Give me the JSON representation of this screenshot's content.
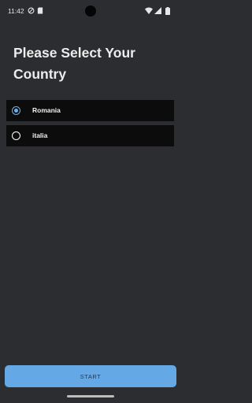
{
  "status_bar": {
    "time": "11:42",
    "left_icons": [
      "do-not-disturb-icon",
      "sd-card-icon"
    ],
    "right_icons": [
      "wifi-icon",
      "signal-icon",
      "battery-icon"
    ]
  },
  "page": {
    "title": "Please Select Your Country"
  },
  "countries": [
    {
      "label": "Romania",
      "selected": true
    },
    {
      "label": "italia",
      "selected": false
    }
  ],
  "actions": {
    "start_label": "START"
  },
  "colors": {
    "background": "#2b2d30",
    "option_background": "#0c0c0c",
    "accent": "#64a9e6",
    "radio_checked": "#6db2ea"
  }
}
